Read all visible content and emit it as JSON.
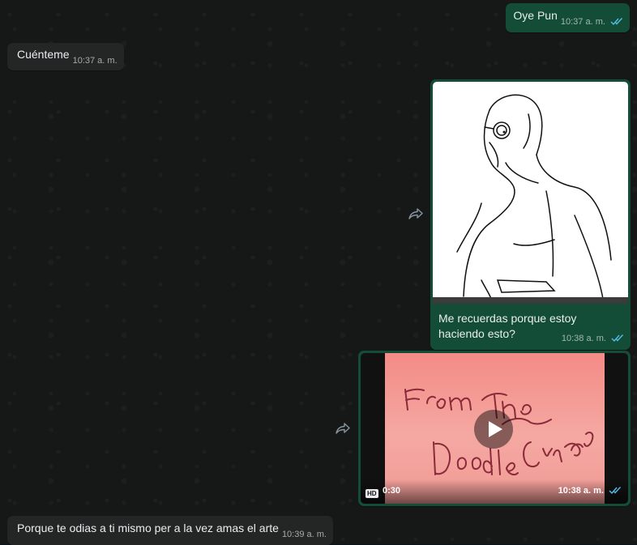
{
  "messages": [
    {
      "id": "m1",
      "direction": "outgoing",
      "text": "Oye Pun",
      "time": "10:37 a. m.",
      "status": "read"
    },
    {
      "id": "m2",
      "direction": "incoming",
      "text": "Cuénteme",
      "time": "10:37 a. m."
    },
    {
      "id": "m3",
      "direction": "outgoing",
      "type": "image",
      "caption": "Me recuerdas porque estoy haciendo esto?",
      "time": "10:38 a. m.",
      "status": "read",
      "forward_icon": "forward-icon"
    },
    {
      "id": "m4",
      "direction": "outgoing",
      "type": "video",
      "hd_label": "HD",
      "duration": "0:30",
      "time": "10:38 a. m.",
      "status": "read",
      "forward_icon": "forward-icon"
    },
    {
      "id": "m5",
      "direction": "incoming",
      "text": "Porque te odias a ti mismo per a la vez amas el arte",
      "time": "10:39 a. m."
    }
  ],
  "colors": {
    "incoming_bubble": "#242626",
    "outgoing_bubble": "#144d37",
    "read_ticks": "#53bdeb",
    "background": "#161717"
  }
}
